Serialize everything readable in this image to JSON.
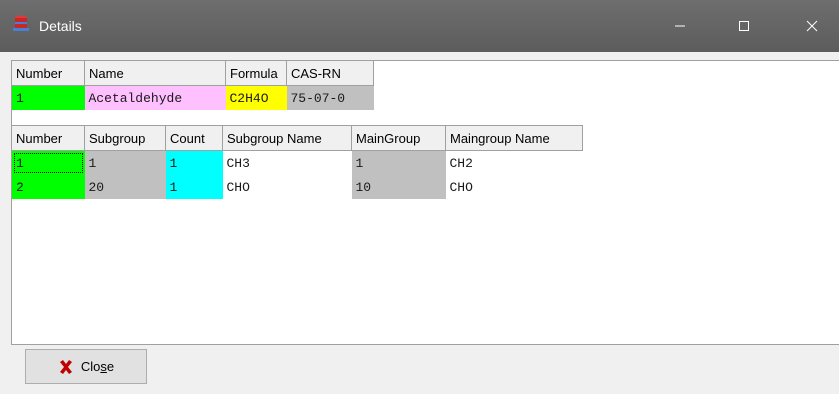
{
  "window": {
    "title": "Details",
    "minimize_icon": "minimize-icon",
    "maximize_icon": "maximize-icon",
    "close_icon": "close-icon"
  },
  "compound": {
    "headers": [
      "Number",
      "Name",
      "Formula",
      "CAS-RN"
    ],
    "row": {
      "number": "1",
      "name": "Acetaldehyde",
      "formula": "C2H4O",
      "cas_rn": "75-07-0"
    }
  },
  "subgroups": {
    "headers": [
      "Number",
      "Subgroup",
      "Count",
      "Subgroup Name",
      "MainGroup",
      "Maingroup Name"
    ],
    "rows": [
      [
        "1",
        "1",
        "1",
        "CH3",
        "1",
        "CH2"
      ],
      [
        "2",
        "20",
        "1",
        "CHO",
        "10",
        "CHO"
      ]
    ]
  },
  "buttons": {
    "close_prefix": "Clo",
    "close_underlined": "s",
    "close_suffix": "e"
  },
  "colors": {
    "number": "#00ff00",
    "name": "#ffc0ff",
    "formula": "#ffff00",
    "cas": "#c0c0c0",
    "count": "#00ffff",
    "titlebar": "#5c5c5c"
  }
}
